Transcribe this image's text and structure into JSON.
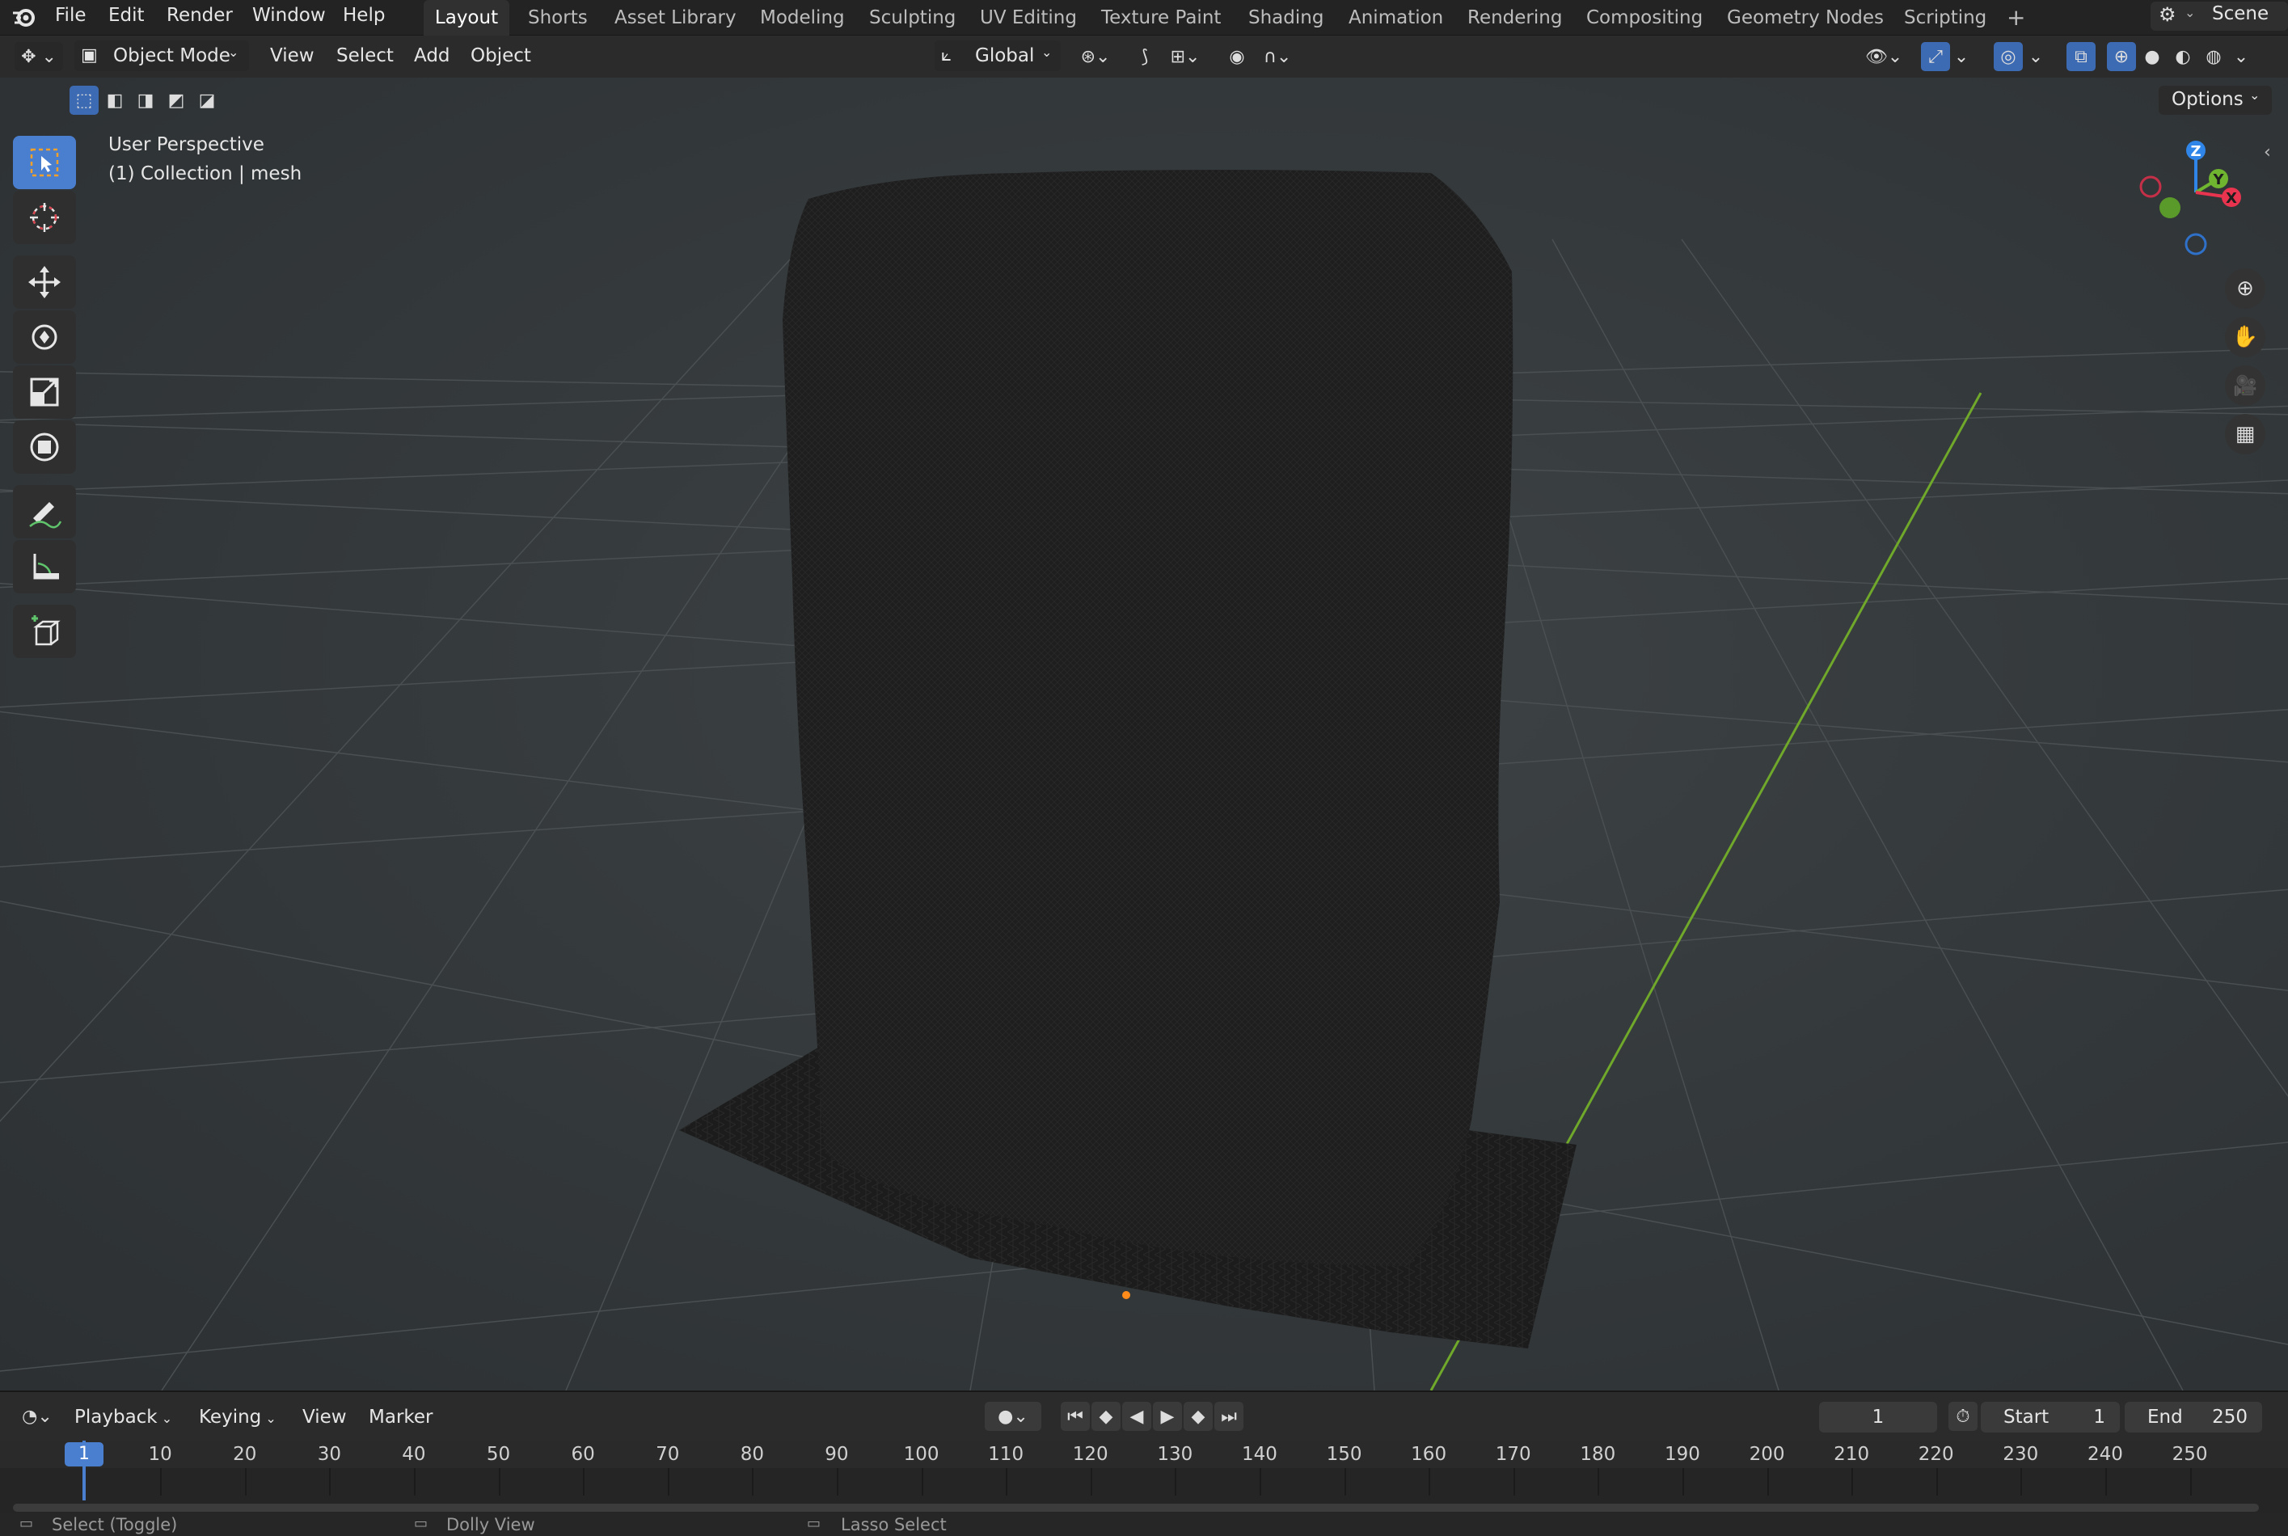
{
  "menubar": {
    "menus": [
      "File",
      "Edit",
      "Render",
      "Window",
      "Help"
    ],
    "workspaces": [
      "Layout",
      "Shorts",
      "Asset Library",
      "Modeling",
      "Sculpting",
      "UV Editing",
      "Texture Paint",
      "Shading",
      "Animation",
      "Rendering",
      "Compositing",
      "Geometry Nodes",
      "Scripting"
    ],
    "active_workspace": "Layout",
    "add_tab": "+",
    "scene_label": "Scene"
  },
  "viewport_header": {
    "mode": "Object Mode",
    "menus": [
      "View",
      "Select",
      "Add",
      "Object"
    ],
    "transform_orientation": "Global",
    "options_label": "Options"
  },
  "viewport": {
    "perspective_label": "User Perspective",
    "collection_label": "(1) Collection | mesh",
    "gizmo": {
      "z": "Z",
      "y": "Y",
      "x": "X"
    }
  },
  "timeline": {
    "menus": [
      "Playback",
      "Keying",
      "View",
      "Marker"
    ],
    "current_frame": "1",
    "start_label": "Start",
    "start_value": "1",
    "end_label": "End",
    "end_value": "250",
    "ruler": [
      "1",
      "10",
      "20",
      "30",
      "40",
      "50",
      "60",
      "70",
      "80",
      "90",
      "100",
      "110",
      "120",
      "130",
      "140",
      "150",
      "160",
      "170",
      "180",
      "190",
      "200",
      "210",
      "220",
      "230",
      "240",
      "250"
    ]
  },
  "statusbar": {
    "items": [
      "Select (Toggle)",
      "Dolly View",
      "Lasso Select"
    ]
  },
  "colors": {
    "accent": "#4a7fd0",
    "y_axis_line": "#6fa82a",
    "gizmo_x": "#e8344e",
    "gizmo_y": "#6fb52f",
    "gizmo_z": "#2f86e8",
    "origin": "#ff8c1a"
  }
}
